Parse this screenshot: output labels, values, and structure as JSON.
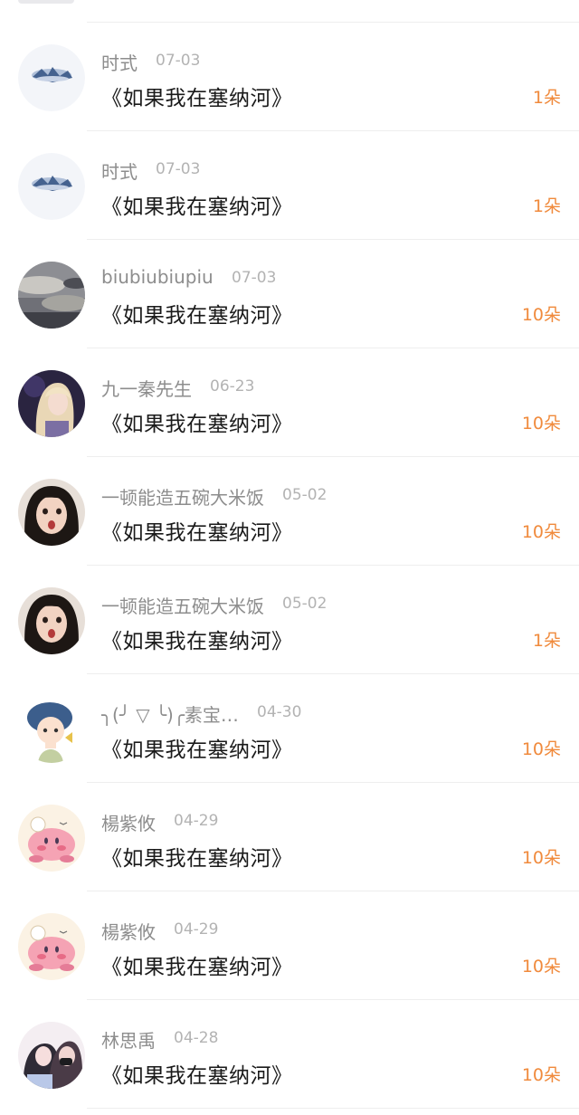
{
  "gifts": [
    {
      "name": "时式",
      "date": "07-03",
      "song": "《如果我在塞纳河》",
      "count": "1朵",
      "avatar": "blue-sky-avatar"
    },
    {
      "name": "时式",
      "date": "07-03",
      "song": "《如果我在塞纳河》",
      "count": "1朵",
      "avatar": "blue-sky-avatar"
    },
    {
      "name": "biubiubiupiu",
      "date": "07-03",
      "song": "《如果我在塞纳河》",
      "count": "10朵",
      "avatar": "cloudy-sky-avatar"
    },
    {
      "name": "九一秦先生",
      "date": "06-23",
      "song": "《如果我在塞纳河》",
      "count": "10朵",
      "avatar": "blonde-girl-avatar"
    },
    {
      "name": "一顿能造五碗大米饭",
      "date": "05-02",
      "song": "《如果我在塞纳河》",
      "count": "10朵",
      "avatar": "surprised-girl-avatar"
    },
    {
      "name": "一顿能造五碗大米饭",
      "date": "05-02",
      "song": "《如果我在塞纳河》",
      "count": "1朵",
      "avatar": "surprised-girl-avatar"
    },
    {
      "name": "╮(╯ ▽ ╰)╭素宝…",
      "date": "04-30",
      "song": "《如果我在塞纳河》",
      "count": "10朵",
      "avatar": "cartoon-boy-avatar"
    },
    {
      "name": "楊紫攸",
      "date": "04-29",
      "song": "《如果我在塞纳河》",
      "count": "10朵",
      "avatar": "pink-kirby-avatar"
    },
    {
      "name": "楊紫攸",
      "date": "04-29",
      "song": "《如果我在塞纳河》",
      "count": "10朵",
      "avatar": "pink-kirby-avatar"
    },
    {
      "name": "林思禹",
      "date": "04-28",
      "song": "《如果我在塞纳河》",
      "count": "10朵",
      "avatar": "couple-illustration-avatar"
    }
  ],
  "colors": {
    "count_orange": "#f08a3c",
    "name_gray": "#8d8d8d",
    "date_gray": "#b3b3b3",
    "song_black": "#1a1a1a",
    "divider": "#eeeeee"
  }
}
